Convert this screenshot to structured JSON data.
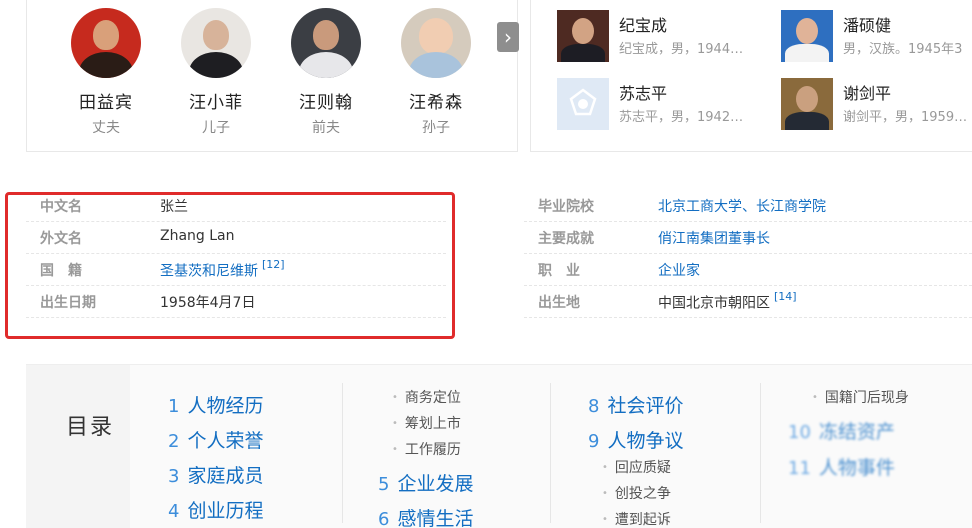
{
  "family": [
    {
      "name": "田益宾",
      "relation": "丈夫"
    },
    {
      "name": "汪小菲",
      "relation": "儿子"
    },
    {
      "name": "汪则翰",
      "relation": "前夫"
    },
    {
      "name": "汪希森",
      "relation": "孙子"
    }
  ],
  "more_arrow": "›",
  "related_people": [
    {
      "name": "纪宝成",
      "desc": "纪宝成，男，1944…"
    },
    {
      "name": "潘硕健",
      "desc": "男，汉族。1945年3"
    },
    {
      "name": "苏志平",
      "desc": "苏志平，男，1942…"
    },
    {
      "name": "谢剑平",
      "desc": "谢剑平，男，1959…"
    }
  ],
  "basic_info": {
    "left": [
      {
        "label": "中文名",
        "value": "张兰",
        "link": false,
        "ref": ""
      },
      {
        "label": "外文名",
        "value": "Zhang Lan",
        "link": false,
        "ref": ""
      },
      {
        "label": "国　籍",
        "value": "圣基茨和尼维斯",
        "link": true,
        "ref": "[12]"
      },
      {
        "label": "出生日期",
        "value": "1958年4月7日",
        "link": false,
        "ref": ""
      }
    ],
    "right": [
      {
        "label": "毕业院校",
        "value": "北京工商大学、长江商学院",
        "link": true,
        "ref": ""
      },
      {
        "label": "主要成就",
        "value": "俏江南集团董事长",
        "link": true,
        "ref": ""
      },
      {
        "label": "职　业",
        "value": "企业家",
        "link": true,
        "ref": ""
      },
      {
        "label": "出生地",
        "value": "中国北京市朝阳区",
        "link": false,
        "ref": "[14]"
      }
    ]
  },
  "toc": {
    "title": "目录",
    "col1": [
      {
        "num": "1",
        "text": "人物经历"
      },
      {
        "num": "2",
        "text": "个人荣誉"
      },
      {
        "num": "3",
        "text": "家庭成员"
      },
      {
        "num": "4",
        "text": "创业历程"
      }
    ],
    "col2_sub": [
      "商务定位",
      "筹划上市",
      "工作履历"
    ],
    "col2_main": [
      {
        "num": "5",
        "text": "企业发展"
      },
      {
        "num": "6",
        "text": "感情生活"
      }
    ],
    "col3_main": [
      {
        "num": "8",
        "text": "社会评价"
      },
      {
        "num": "9",
        "text": "人物争议"
      }
    ],
    "col3_sub": [
      "回应质疑",
      "创投之争",
      "遭到起诉"
    ],
    "col4_sub": [
      "国籍门后现身"
    ],
    "col4_main": [
      {
        "num": "10",
        "text": "冻结资产"
      },
      {
        "num": "11",
        "text": "人物事件"
      }
    ]
  },
  "colors": {
    "link": "#136ec2",
    "highlight": "#e02b2b",
    "label": "#999999"
  }
}
